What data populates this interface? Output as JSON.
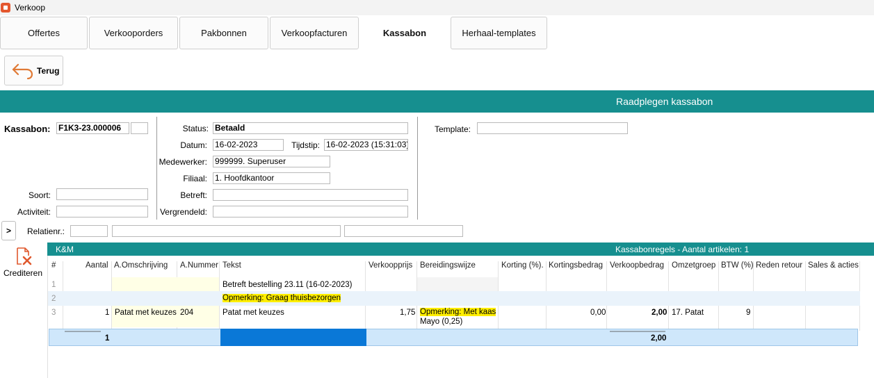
{
  "window": {
    "title": "Verkoop"
  },
  "tabs": [
    {
      "label": "Offertes"
    },
    {
      "label": "Verkooporders"
    },
    {
      "label": "Pakbonnen"
    },
    {
      "label": "Verkoopfacturen"
    },
    {
      "label": "Kassabon"
    },
    {
      "label": "Herhaal-templates"
    }
  ],
  "active_tab": "Kassabon",
  "toolbar": {
    "back_label": "Terug"
  },
  "header": {
    "title": "Raadplegen kassabon"
  },
  "form": {
    "kassabon_label": "Kassabon:",
    "kassabon_value": "F1K3-23.000006",
    "kassabon_extra": "",
    "soort_label": "Soort:",
    "soort_value": "",
    "activiteit_label": "Activiteit:",
    "activiteit_value": "",
    "status_label": "Status:",
    "status_value": "Betaald",
    "datum_label": "Datum:",
    "datum_value": "16-02-2023",
    "tijdstip_label": "Tijdstip:",
    "tijdstip_value": "16-02-2023 (15:31:03)",
    "medewerker_label": "Medewerker:",
    "medewerker_value": "999999. Superuser",
    "filiaal_label": "Filiaal:",
    "filiaal_value": "1. Hoofdkantoor",
    "betreft_label": "Betreft:",
    "betreft_value": "",
    "vergrendeld_label": "Vergrendeld:",
    "vergrendeld_value": "",
    "template_label": "Template:",
    "template_value": "",
    "relatienr_label": "Relatienr.:",
    "relatienr_value": "",
    "relatie_naam": "",
    "relatie_extra": ""
  },
  "expand_label": ">",
  "side_actions": {
    "crediteren_label": "Crediteren"
  },
  "grid": {
    "band_left": "K&M",
    "band_right": "Kassabonregels - Aantal artikelen: 1",
    "columns": [
      "#",
      "Aantal",
      "A.Omschrijving",
      "A.Nummer",
      "Tekst",
      "Verkoopprijs",
      "Bereidingswijze",
      "Korting (%).",
      "Kortingsbedrag",
      "Verkoopbedrag",
      "Omzetgroep",
      "BTW (%)",
      "Reden retour",
      "Sales & acties"
    ],
    "rows": [
      {
        "num": "1",
        "tekst": "Betreft bestelling 23.11 (16-02-2023)"
      },
      {
        "num": "2",
        "tekst": "Opmerking: Graag thuisbezorgen"
      },
      {
        "num": "3",
        "aantal": "1",
        "omschrijving": "Patat met keuzes",
        "nummer": "204",
        "tekst": "Patat met keuzes",
        "verkoopprijs": "1,75",
        "bereiding_1": "Opmerking: Met kaas",
        "bereiding_2": "Mayo (0,25)",
        "kortingsbedrag": "0,00",
        "verkoopbedrag": "2,00",
        "omzetgroep": "17. Patat",
        "btw": "9"
      }
    ],
    "totals": {
      "aantal": "1",
      "verkoopbedrag": "2,00"
    }
  },
  "colors": {
    "teal": "#168f8f",
    "highlight": "#ffee00",
    "selection": "#0a78d7"
  }
}
